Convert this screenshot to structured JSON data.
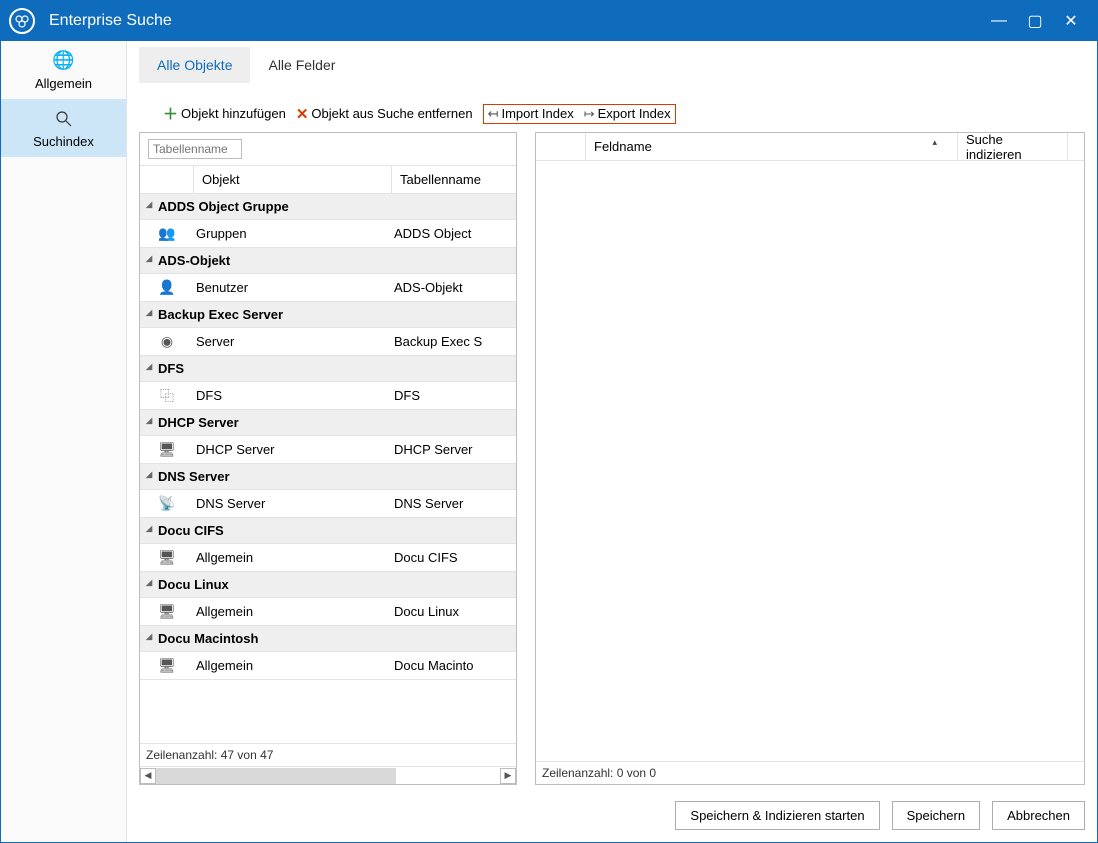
{
  "window": {
    "title": "Enterprise Suche"
  },
  "sidebar": {
    "items": [
      {
        "label": "Allgemein"
      },
      {
        "label": "Suchindex"
      }
    ]
  },
  "tabs": [
    {
      "label": "Alle Objekte",
      "active": true
    },
    {
      "label": "Alle Felder",
      "active": false
    }
  ],
  "toolbar": {
    "add": "Objekt hinzufügen",
    "remove": "Objekt aus Suche entfernen",
    "import": "Import Index",
    "export": "Export Index"
  },
  "leftGrid": {
    "filter_placeholder": "Tabellenname",
    "columns": {
      "object": "Objekt",
      "tablename": "Tabellenname"
    },
    "groups": [
      {
        "name": "ADDS Object Gruppe",
        "rows": [
          {
            "icon": "👥",
            "object": "Gruppen",
            "tablename": "ADDS Object"
          }
        ]
      },
      {
        "name": "ADS-Objekt",
        "rows": [
          {
            "icon": "👤",
            "object": "Benutzer",
            "tablename": "ADS-Objekt"
          }
        ]
      },
      {
        "name": "Backup Exec Server",
        "rows": [
          {
            "icon": "◉",
            "object": "Server",
            "tablename": "Backup Exec S"
          }
        ]
      },
      {
        "name": "DFS",
        "rows": [
          {
            "icon": "⿻",
            "object": "DFS",
            "tablename": "DFS"
          }
        ]
      },
      {
        "name": "DHCP Server",
        "rows": [
          {
            "icon": "🖥",
            "object": "DHCP Server",
            "tablename": "DHCP Server"
          }
        ]
      },
      {
        "name": "DNS Server",
        "rows": [
          {
            "icon": "📡",
            "object": "DNS Server",
            "tablename": "DNS Server"
          }
        ]
      },
      {
        "name": "Docu CIFS",
        "rows": [
          {
            "icon": "🖥",
            "object": "Allgemein",
            "tablename": "Docu CIFS"
          }
        ]
      },
      {
        "name": "Docu Linux",
        "rows": [
          {
            "icon": "🖥",
            "object": "Allgemein",
            "tablename": "Docu Linux"
          }
        ]
      },
      {
        "name": "Docu Macintosh",
        "rows": [
          {
            "icon": "🖥",
            "object": "Allgemein",
            "tablename": "Docu Macinto"
          }
        ]
      }
    ],
    "rowcount": "Zeilenanzahl: 47 von 47"
  },
  "rightGrid": {
    "columns": {
      "fieldname": "Feldname",
      "index": "Suche indizieren"
    },
    "rowcount": "Zeilenanzahl: 0 von 0"
  },
  "buttons": {
    "save_index": "Speichern & Indizieren starten",
    "save": "Speichern",
    "cancel": "Abbrechen"
  }
}
